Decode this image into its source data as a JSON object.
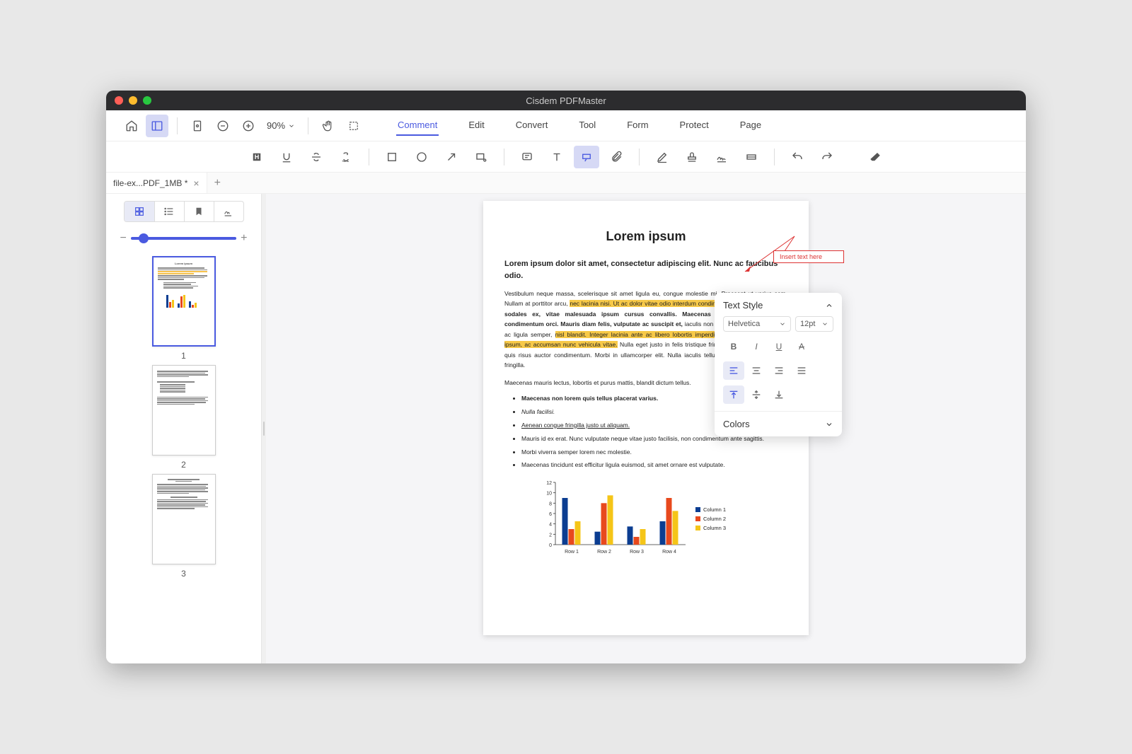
{
  "titlebar": {
    "title": "Cisdem PDFMaster"
  },
  "toolbar1": {
    "zoom": "90%"
  },
  "menu": {
    "tabs": [
      "Comment",
      "Edit",
      "Convert",
      "Tool",
      "Form",
      "Protect",
      "Page"
    ],
    "active": 0
  },
  "tabs": {
    "doc_name": "file-ex...PDF_1MB *"
  },
  "thumbnails": {
    "labels": [
      "1",
      "2",
      "3"
    ],
    "selected": 0
  },
  "document": {
    "h1": "Lorem ipsum",
    "h2": "Lorem ipsum dolor sit amet, consectetur adipiscing elit. Nunc ac faucibus odio.",
    "p1_pre": "Vestibulum neque massa, scelerisque sit amet ligula eu, congue molestie mi. Praesent ut varius sem. Nullam at porttitor arcu, ",
    "p1_hl1": "nec lacinia nisi. Ut ac dolor vitae odio interdum condimentum.",
    "p1_mid": " Vivamus dapibus sodales ex, vitae malesuada ipsum cursus convallis. Maecenas sed egestas nulla, ac condimentum orci. Mauris diam felis, vulputate ac suscipit et, ",
    "p1_mid2": "iaculis non est. Curabitur semper arcu ac ligula semper, ",
    "p1_hl2": "nisl blandit. Integer lacinia ante ac libero lobortis imperdiet. Nullam mollis convallis ipsum, ac accumsan nunc vehicula vitae.",
    "p1_post": " Nulla eget justo in felis tristique fringilla. Morbi sit amet tortor quis risus auctor condimentum. Morbi in ullamcorper elit. Nulla iaculis tellus sit amet mauris tempus fringilla.",
    "p2": "Maecenas mauris lectus, lobortis et purus mattis, blandit dictum tellus.",
    "list": [
      "Maecenas non lorem quis tellus placerat varius.",
      "Nulla facilisi.",
      "Aenean congue fringilla justo ut aliquam.",
      "Mauris id ex erat. Nunc vulputate neque vitae justo facilisis, non condimentum ante sagittis.",
      "Morbi viverra semper lorem nec molestie.",
      "Maecenas tincidunt est efficitur ligula euismod, sit amet ornare est vulputate."
    ],
    "callout_text": "Insert text here"
  },
  "chart_data": {
    "type": "bar",
    "categories": [
      "Row 1",
      "Row 2",
      "Row 3",
      "Row 4"
    ],
    "series": [
      {
        "name": "Column 1",
        "color": "#0b3d91",
        "values": [
          9,
          2.5,
          3.5,
          4.5
        ]
      },
      {
        "name": "Column 2",
        "color": "#e8491d",
        "values": [
          3,
          8,
          1.5,
          9
        ]
      },
      {
        "name": "Column 3",
        "color": "#f5c518",
        "values": [
          4.5,
          9.5,
          3,
          6.5
        ]
      }
    ],
    "ylim": [
      0,
      12
    ],
    "yticks": [
      0,
      2,
      4,
      6,
      8,
      10,
      12
    ]
  },
  "popover": {
    "title": "Text Style",
    "font": "Helvetica",
    "size": "12pt",
    "colors_label": "Colors"
  }
}
